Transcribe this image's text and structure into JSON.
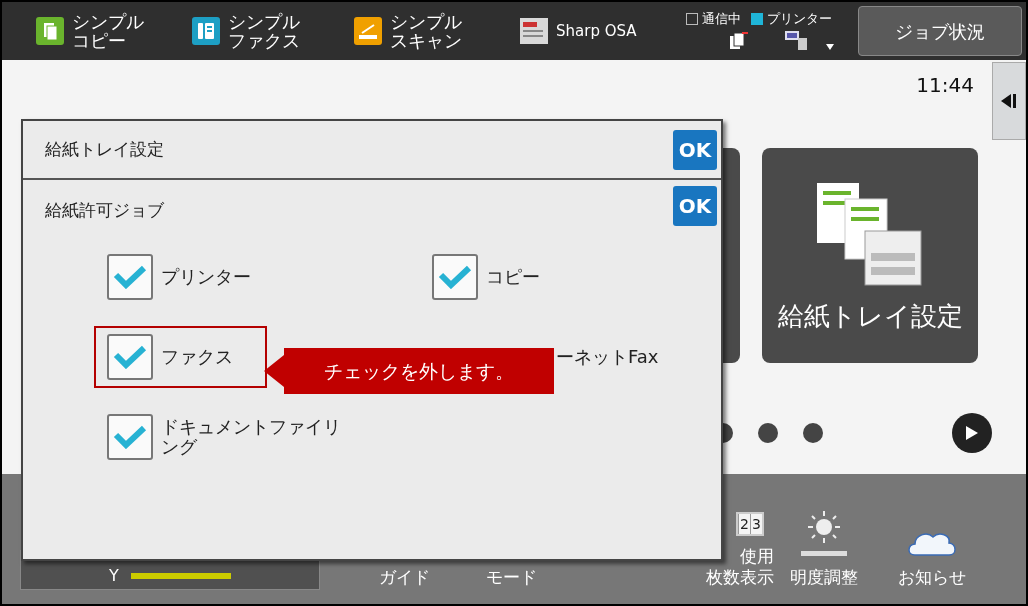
{
  "top_bar": {
    "apps": [
      {
        "kind": "copy",
        "lines": [
          "シンプル",
          "コピー"
        ]
      },
      {
        "kind": "fax",
        "lines": [
          "シンプル",
          "ファクス"
        ]
      },
      {
        "kind": "scan",
        "lines": [
          "シンプル",
          "スキャン"
        ]
      },
      {
        "kind": "osa",
        "lines": [
          "Sharp OSA"
        ]
      }
    ],
    "indicators": [
      {
        "label": "通信中",
        "on": false
      },
      {
        "label": "プリンター",
        "on": true
      }
    ],
    "job_status_button": "ジョブ状況"
  },
  "clock": "11:44",
  "home_tile": {
    "label": "給紙トレイ設定"
  },
  "page_dots": [
    {
      "selected": false
    },
    {
      "selected": false
    },
    {
      "selected": false
    }
  ],
  "bottom_bar": {
    "toner": {
      "label": "Y",
      "level": 1
    },
    "items": [
      {
        "kind": "text",
        "lines": [
          "ガイド"
        ]
      },
      {
        "kind": "text",
        "lines": [
          "モード"
        ]
      },
      {
        "kind": "counter",
        "lines": [
          "使用",
          "枚数表示"
        ],
        "digits": [
          "2",
          "3"
        ]
      },
      {
        "kind": "brightness",
        "lines": [
          "明度調整"
        ]
      },
      {
        "kind": "news",
        "lines": [
          "お知らせ"
        ]
      }
    ]
  },
  "dialog": {
    "title": "給紙トレイ設定",
    "ok": "OK",
    "section": {
      "title": "給紙許可ジョブ",
      "ok": "OK"
    },
    "options": [
      {
        "label": "プリンター",
        "checked": true,
        "highlighted": false
      },
      {
        "label": "コピー",
        "checked": true,
        "highlighted": false
      },
      {
        "label": "ファクス",
        "checked": true,
        "highlighted": true
      },
      {
        "label": "ーネットFax",
        "highlighted": false
      },
      {
        "label": "ドキュメントファイリング",
        "checked": true,
        "highlighted": false
      }
    ]
  },
  "callout": "チェックを外します。"
}
